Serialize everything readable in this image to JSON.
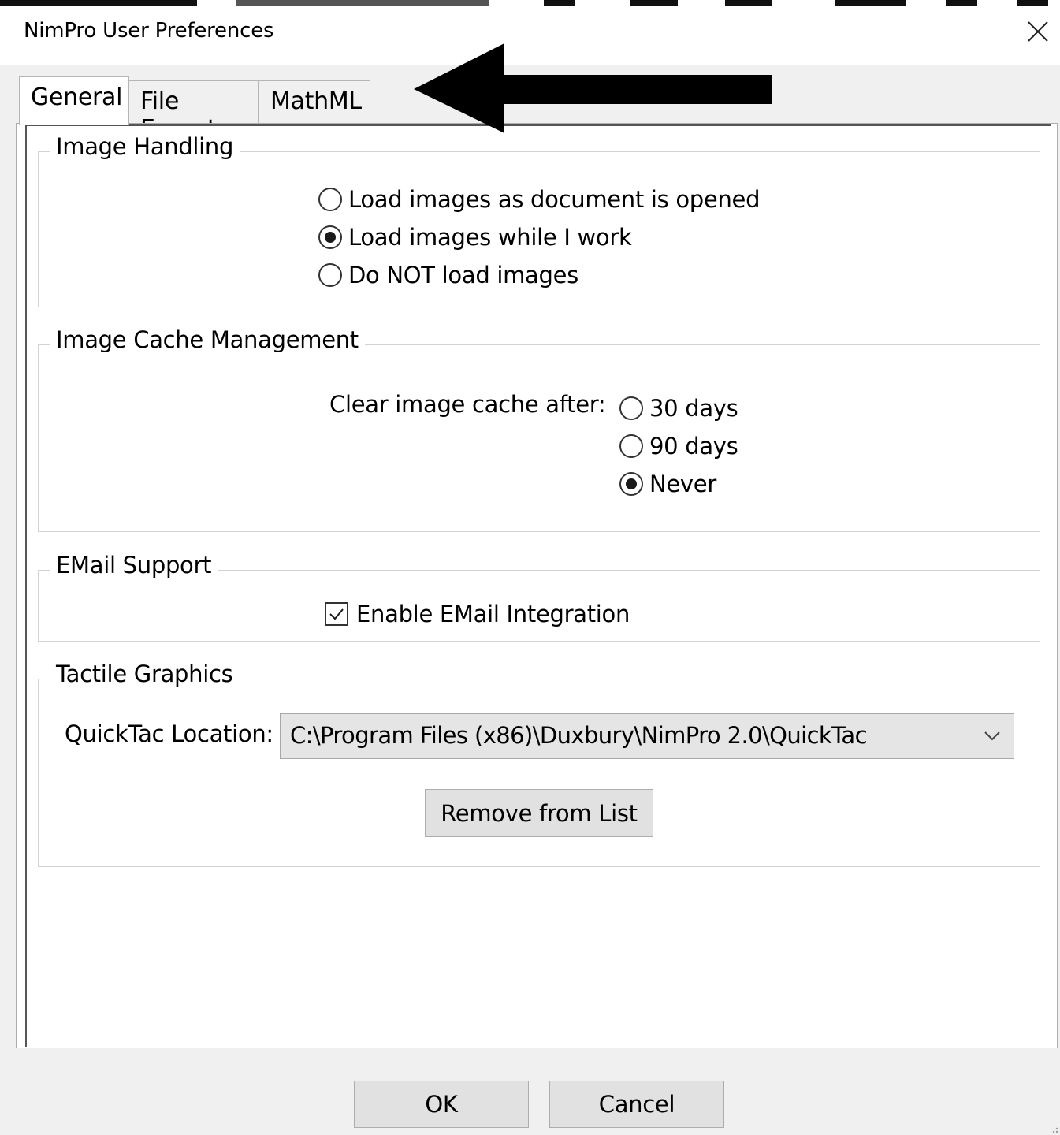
{
  "dialog": {
    "title": "NimPro User Preferences"
  },
  "tabs": [
    {
      "label": "General",
      "active": true
    },
    {
      "label": "File Export",
      "active": false
    },
    {
      "label": "MathML",
      "active": false
    }
  ],
  "image_handling": {
    "title": "Image Handling",
    "options": [
      {
        "label": "Load images as document is opened",
        "checked": false
      },
      {
        "label": "Load images while I work",
        "checked": true
      },
      {
        "label": "Do NOT load images",
        "checked": false
      }
    ]
  },
  "image_cache": {
    "title": "Image Cache Management",
    "prompt": "Clear image cache after:",
    "options": [
      {
        "label": "30 days",
        "checked": false
      },
      {
        "label": "90 days",
        "checked": false
      },
      {
        "label": "Never",
        "checked": true
      }
    ]
  },
  "email": {
    "title": "EMail Support",
    "checkbox_label": "Enable EMail Integration",
    "checked": true
  },
  "tactile": {
    "title": "Tactile Graphics",
    "location_label": "QuickTac Location:",
    "location_value": "C:\\Program Files (x86)\\Duxbury\\NimPro 2.0\\QuickTac",
    "remove_label": "Remove from List"
  },
  "buttons": {
    "ok": "OK",
    "cancel": "Cancel"
  },
  "icons": {
    "close": "close-icon",
    "dropdown": "chevron-down-icon",
    "annotation": "arrow-left-icon"
  }
}
